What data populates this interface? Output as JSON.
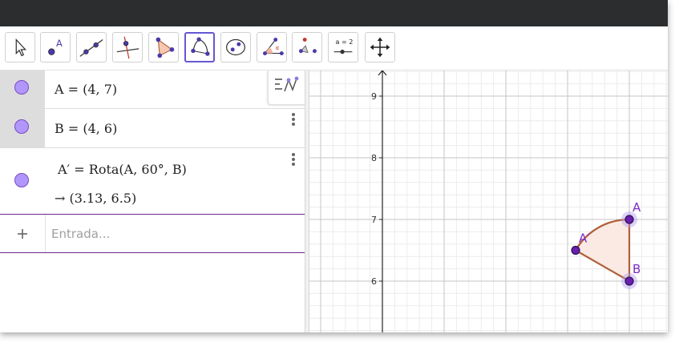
{
  "toolbar": {
    "tools": [
      {
        "name": "move-tool",
        "icon": "cursor-arrow-icon"
      },
      {
        "name": "point-tool",
        "icon": "point-icon",
        "label": "A"
      },
      {
        "name": "line-tool",
        "icon": "line-through-two-points-icon"
      },
      {
        "name": "perpendicular-line-tool",
        "icon": "perpendicular-line-icon"
      },
      {
        "name": "polygon-tool",
        "icon": "polygon-icon"
      },
      {
        "name": "circle-through-points-tool",
        "icon": "circular-arc-icon",
        "active": true
      },
      {
        "name": "conic-tool",
        "icon": "ellipse-icon"
      },
      {
        "name": "angle-tool",
        "icon": "angle-icon",
        "label": "α"
      },
      {
        "name": "reflect-tool",
        "icon": "transformation-icon"
      },
      {
        "name": "slider-tool",
        "icon": "slider-icon",
        "label": "a = 2"
      },
      {
        "name": "move-graphics-view-tool",
        "icon": "move-arrows-icon"
      }
    ]
  },
  "algebra": {
    "rows": [
      {
        "text": "A = (4, 7)",
        "selected": true
      },
      {
        "text": "B = (4, 6)",
        "selected": true
      },
      {
        "text": "A′ = Rota(A, 60°, B)",
        "result": "→  (3.13, 6.5)",
        "selected": false
      }
    ],
    "input_placeholder": "Entrada..."
  },
  "graphics": {
    "y_ticks": [
      "9",
      "8",
      "7",
      "6"
    ],
    "points": [
      {
        "label": "A",
        "x": 4,
        "y": 7
      },
      {
        "label": "B",
        "x": 4,
        "y": 6
      },
      {
        "label": "A′",
        "x": 3.13,
        "y": 6.5
      }
    ],
    "colors": {
      "point_fill": "#6a1fb0",
      "point_label": "#7a2cc8",
      "sector_stroke": "#b0603a",
      "sector_fill": "#fbe9e3"
    }
  }
}
